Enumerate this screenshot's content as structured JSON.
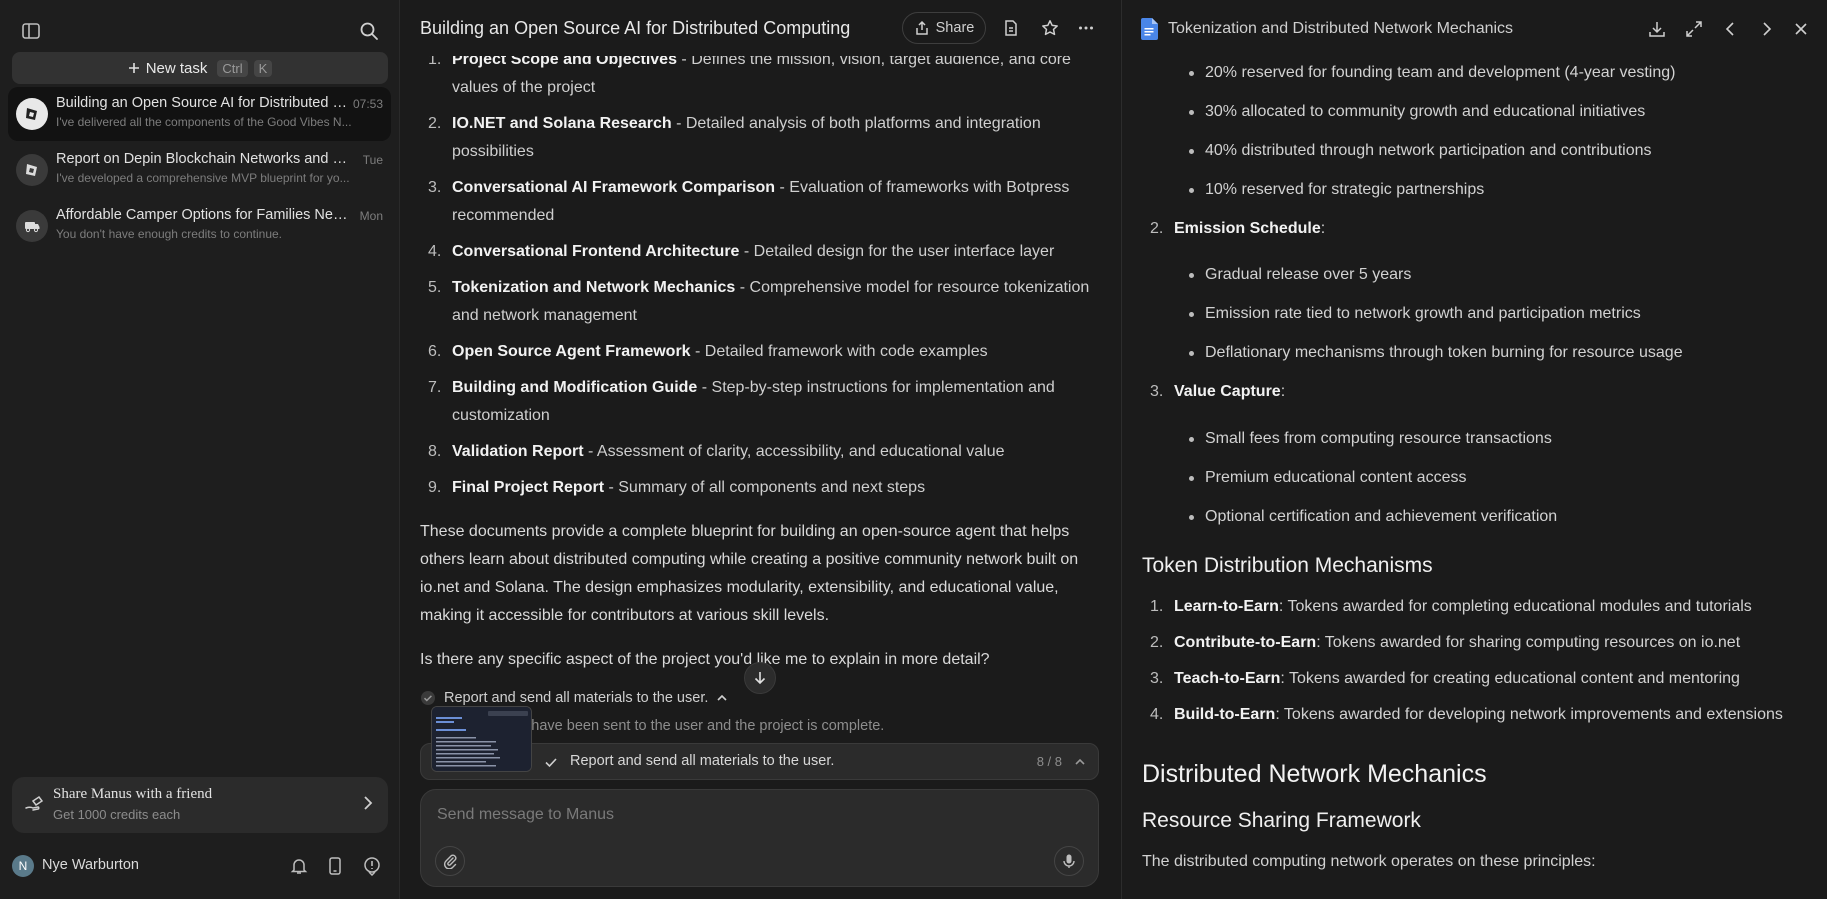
{
  "sidebar": {
    "new_task_label": "New task",
    "shortcut_ctrl": "Ctrl",
    "shortcut_key": "K",
    "tasks": [
      {
        "title": "Building an Open Source AI for Distributed C...",
        "subtitle": "I've delivered all the components of the Good Vibes N...",
        "time": "07:53",
        "active": true
      },
      {
        "title": "Report on Depin Blockchain Networks and Dis...",
        "subtitle": "I've developed a comprehensive MVP blueprint for yo...",
        "time": "Tue",
        "active": false
      },
      {
        "title": "Affordable Camper Options for Families Near ...",
        "subtitle": "You don't have enough credits to continue.",
        "time": "Mon",
        "active": false
      }
    ],
    "share_card": {
      "title": "Share Manus with a friend",
      "subtitle": "Get 1000 credits each"
    },
    "user": {
      "initial": "N",
      "name": "Nye Warburton"
    }
  },
  "main": {
    "title": "Building an Open Source AI for Distributed Computing",
    "share_label": "Share",
    "deliverables": [
      {
        "num": "1.",
        "bold": "Project Scope and Objectives",
        "text": " - Defines the mission, vision, target audience, and core values of the project"
      },
      {
        "num": "2.",
        "bold": "IO.NET and Solana Research",
        "text": " - Detailed analysis of both platforms and integration possibilities"
      },
      {
        "num": "3.",
        "bold": "Conversational AI Framework Comparison",
        "text": " - Evaluation of frameworks with Botpress recommended"
      },
      {
        "num": "4.",
        "bold": "Conversational Frontend Architecture",
        "text": " - Detailed design for the user interface layer"
      },
      {
        "num": "5.",
        "bold": "Tokenization and Network Mechanics",
        "text": " - Comprehensive model for resource tokenization and network management"
      },
      {
        "num": "6.",
        "bold": "Open Source Agent Framework",
        "text": " - Detailed framework with code examples"
      },
      {
        "num": "7.",
        "bold": "Building and Modification Guide",
        "text": " - Step-by-step instructions for implementation and customization"
      },
      {
        "num": "8.",
        "bold": "Validation Report",
        "text": " - Assessment of clarity, accessibility, and educational value"
      },
      {
        "num": "9.",
        "bold": "Final Project Report",
        "text": " - Summary of all components and next steps"
      }
    ],
    "paragraph": "These documents provide a complete blueprint for building an open-source agent that helps others learn about distributed computing while creating a positive community network built on io.net and Solana. The design emphasizes modularity, extensibility, and educational value, making it accessible for contributors at various skill levels.",
    "question": "Is there any specific aspect of the project you'd like me to explain in more detail?",
    "step_done": "Report and send all materials to the user.",
    "step_note": "s have been sent to the user and the project is complete.",
    "progress": {
      "label": "Report and send all materials to the user.",
      "count": "8 / 8"
    },
    "composer_placeholder": "Send message to Manus"
  },
  "panel": {
    "title": "Tokenization and Distributed Network Mechanics",
    "top_bullets": [
      "20% reserved for founding team and development (4-year vesting)",
      "30% allocated to community growth and educational initiatives",
      "40% distributed through network participation and contributions",
      "10% reserved for strategic partnerships"
    ],
    "emission": {
      "num": "2.",
      "bold": "Emission Schedule",
      "colon": ":"
    },
    "emission_bullets": [
      "Gradual release over 5 years",
      "Emission rate tied to network growth and participation metrics",
      "Deflationary mechanisms through token burning for resource usage"
    ],
    "value": {
      "num": "3.",
      "bold": "Value Capture",
      "colon": ":"
    },
    "value_bullets": [
      "Small fees from computing resource transactions",
      "Premium educational content access",
      "Optional certification and achievement verification"
    ],
    "h_token_dist": "Token Distribution Mechanisms",
    "mechanisms": [
      {
        "num": "1.",
        "bold": "Learn-to-Earn",
        "text": ": Tokens awarded for completing educational modules and tutorials"
      },
      {
        "num": "2.",
        "bold": "Contribute-to-Earn",
        "text": ": Tokens awarded for sharing computing resources on io.net"
      },
      {
        "num": "3.",
        "bold": "Teach-to-Earn",
        "text": ": Tokens awarded for creating educational content and mentoring"
      },
      {
        "num": "4.",
        "bold": "Build-to-Earn",
        "text": ": Tokens awarded for developing network improvements and extensions"
      }
    ],
    "h_network": "Distributed Network Mechanics",
    "h_resource": "Resource Sharing Framework",
    "intro": "The distributed computing network operates on these principles:"
  }
}
